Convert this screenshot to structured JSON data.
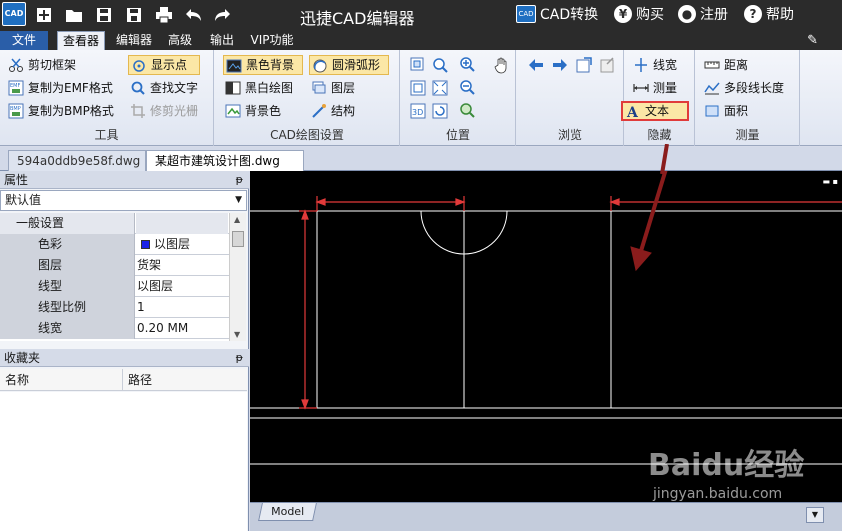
{
  "app": {
    "title": "迅捷CAD编辑器",
    "logo_text": "CAD",
    "cad_convert": "CAD转换",
    "buy": "购买",
    "register": "注册",
    "help": "帮助"
  },
  "menu": {
    "file": "文件",
    "tabs": [
      "查看器",
      "编辑器",
      "高级",
      "输出",
      "VIP功能"
    ]
  },
  "ribbon": {
    "tools": {
      "title": "工具",
      "clip_frame": "剪切框架",
      "copy_emf": "复制为EMF格式",
      "copy_bmp": "复制为BMP格式",
      "show_points": "显示点",
      "find_text": "查找文字",
      "trim_raster": "修剪光栅"
    },
    "cad_settings": {
      "title": "CAD绘图设置",
      "black_bg": "黑色背景",
      "smooth_arc": "圆滑弧形",
      "bw_drawing": "黑白绘图",
      "layers": "图层",
      "bg_color": "背景色",
      "structure": "结构"
    },
    "position": {
      "title": "位置"
    },
    "browse": {
      "title": "浏览"
    },
    "hide": {
      "title": "隐藏",
      "line_width": "线宽",
      "measure": "测量",
      "text": "文本"
    },
    "measure": {
      "title": "测量",
      "distance": "距离",
      "polyline_length": "多段线长度",
      "area": "面积"
    }
  },
  "doc_tabs": [
    {
      "label": "594a0ddb9e58f.dwg",
      "active": false
    },
    {
      "label": "某超市建筑设计图.dwg",
      "active": true
    }
  ],
  "properties": {
    "header": "属性",
    "pin": "ꟷ",
    "selected": "默认值",
    "group": "一般设置",
    "rows": [
      {
        "key": "色彩",
        "value": "以图层"
      },
      {
        "key": "图层",
        "value": "货架"
      },
      {
        "key": "线型",
        "value": "以图层"
      },
      {
        "key": "线型比例",
        "value": "1"
      },
      {
        "key": "线宽",
        "value": "0.20 MM"
      }
    ]
  },
  "favorites": {
    "header": "收藏夹",
    "col_name": "名称",
    "col_path": "路径"
  },
  "canvas": {
    "model_tab": "Model"
  },
  "watermark": {
    "brand": "Baidu经验",
    "url": "jingyan.baidu.com"
  },
  "colors": {
    "titlebar": "#2b2b2b",
    "highlight": "#fbe7a6",
    "annotation_red": "#e03b3b",
    "drawing_dim_red": "#e23a3a",
    "swatch_blue": "#1a22e8"
  }
}
